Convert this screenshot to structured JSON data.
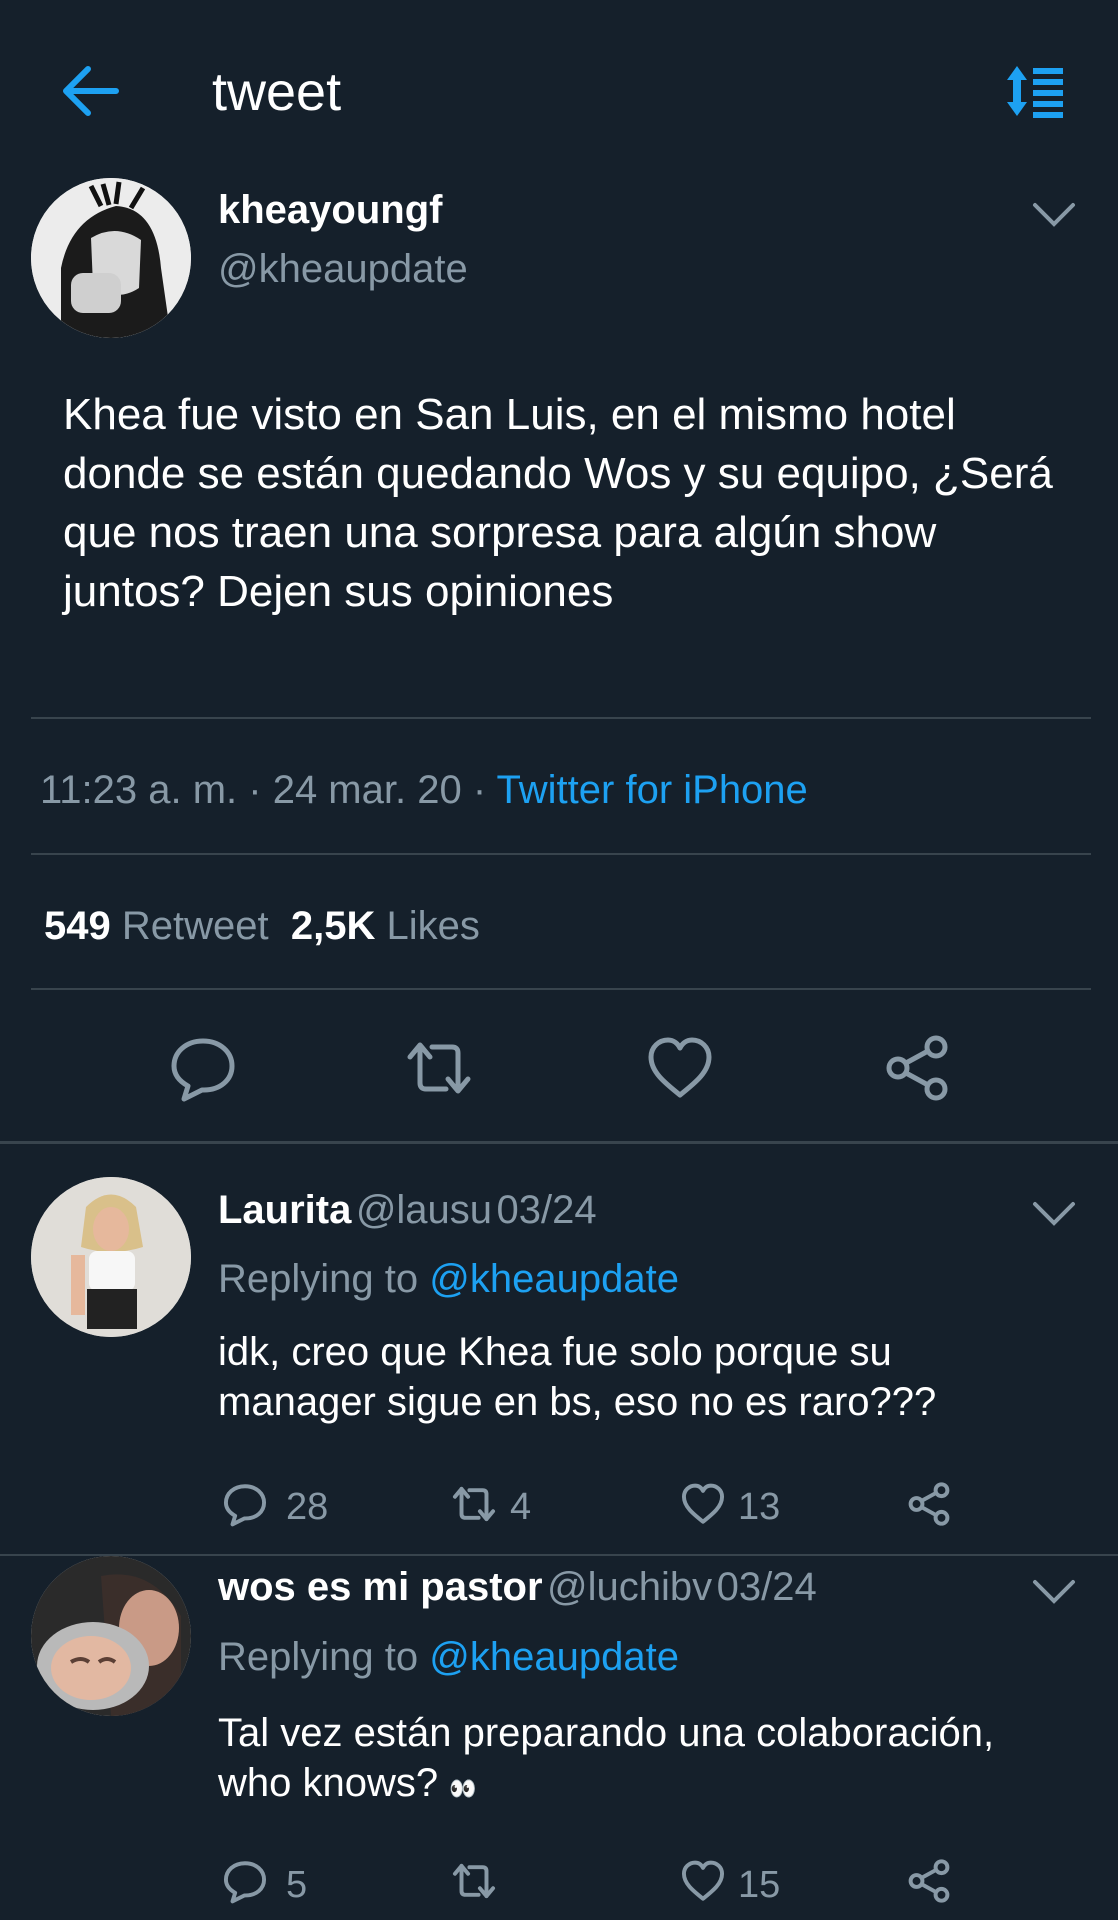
{
  "header": {
    "title": "tweet",
    "back_icon": "arrow-left-icon",
    "sort_icon": "sort-list-icon"
  },
  "tweet": {
    "author_name": "kheayoungf",
    "author_handle": "@kheaupdate",
    "text": "Khea fue visto en San Luis, en el mismo hotel donde se están quedando Wos y su equipo, ¿Será que nos traen una sorpresa para algún show juntos? Dejen sus opiniones",
    "time": "11:23 a. m.",
    "sep1": " · ",
    "date": "24 mar. 20",
    "sep2": " · ",
    "source": "Twitter for iPhone",
    "retweet_count": "549",
    "retweet_label": "Retweet",
    "like_count": "2,5K",
    "like_label": "Likes"
  },
  "replies": [
    {
      "name": "Laurita",
      "handle": "@lausu",
      "date": "03/24",
      "replying_prefix": "Replying to",
      "replying_handle": "@kheaupdate",
      "text_line1": "idk, creo que Khea fue solo porque su",
      "text_line2": "manager sigue en bs, eso no es raro???",
      "reply_count": "28",
      "retweet_count": "4",
      "like_count": "13"
    },
    {
      "name": "wos es mi pastor",
      "handle": "@luchibv",
      "date": "03/24",
      "replying_prefix": "Replying to",
      "replying_handle": "@kheaupdate",
      "text_line1": "Tal vez están preparando una colaboración,",
      "text_line2": "who knows?",
      "text_emoji": "👀",
      "reply_count": "5",
      "retweet_count": "",
      "like_count": "15"
    }
  ],
  "colors": {
    "background": "#15202b",
    "accent": "#1da1f2",
    "muted": "#8899a6",
    "divider": "#38444d"
  }
}
